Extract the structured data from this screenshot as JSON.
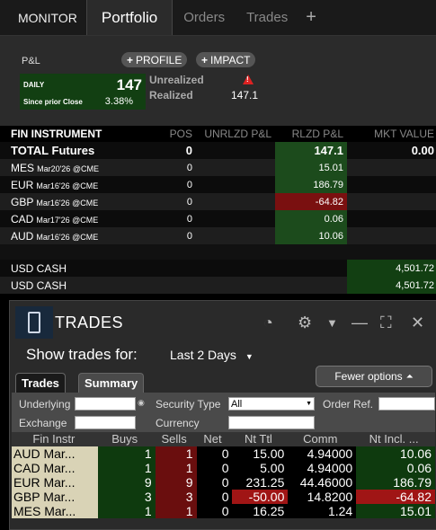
{
  "tabs": {
    "monitor": "MONITOR",
    "portfolio": "Portfolio",
    "orders": "Orders",
    "trades": "Trades",
    "add": "+"
  },
  "pnl": {
    "label": "P&L",
    "profile_btn": "PROFILE",
    "impact_btn": "IMPACT",
    "daily_label": "DAILY",
    "daily_value": "147",
    "since_prior": "Since prior Close",
    "since_pct": "3.38%",
    "unrealized_label": "Unrealized",
    "realized_label": "Realized",
    "realized_value": "147.1"
  },
  "portfolio": {
    "headers": {
      "instrument": "FIN INSTRUMENT",
      "pos": "POS",
      "unrlzd": "UNRLZD P&L",
      "rlzd": "RLZD P&L",
      "mkt": "MKT VALUE"
    },
    "total": {
      "name": "TOTAL Futures",
      "pos": "0",
      "rlzd": "147.1",
      "mkt": "0.00"
    },
    "rows": [
      {
        "sym": "MES",
        "exp": "Mar20'26 @CME",
        "pos": "0",
        "rlzd": "15.01",
        "sign": "pos"
      },
      {
        "sym": "EUR",
        "exp": "Mar16'26 @CME",
        "pos": "0",
        "rlzd": "186.79",
        "sign": "pos"
      },
      {
        "sym": "GBP",
        "exp": "Mar16'26 @CME",
        "pos": "0",
        "rlzd": "-64.82",
        "sign": "neg"
      },
      {
        "sym": "CAD",
        "exp": "Mar17'26 @CME",
        "pos": "0",
        "rlzd": "0.06",
        "sign": "pos"
      },
      {
        "sym": "AUD",
        "exp": "Mar16'26 @CME",
        "pos": "0",
        "rlzd": "10.06",
        "sign": "pos"
      }
    ],
    "cash": [
      {
        "name": "USD CASH",
        "mkt": "4,501.72"
      },
      {
        "name": "USD CASH",
        "mkt": "4,501.72"
      }
    ]
  },
  "trades_panel": {
    "title": "TRADES",
    "show_label": "Show trades for:",
    "range_value": "Last 2 Days",
    "tab_trades": "Trades",
    "tab_summary": "Summary",
    "fewer_options": "Fewer options",
    "filters": {
      "underlying": "Underlying",
      "security_type": "Security Type",
      "security_type_value": "All",
      "order_ref": "Order Ref.",
      "exchange": "Exchange",
      "currency": "Currency"
    },
    "columns": [
      "Fin Instr",
      "Buys",
      "Sells",
      "Net",
      "Nt Ttl",
      "Comm",
      "Nt Incl. ..."
    ],
    "rows": [
      {
        "fi": "AUD Mar...",
        "buys": "1",
        "sells": "1",
        "net": "0",
        "ntttl": "15.00",
        "comm": "4.94000",
        "ntincl": "10.06",
        "ntttl_sign": "pos",
        "ntincl_sign": "pos"
      },
      {
        "fi": "CAD Mar...",
        "buys": "1",
        "sells": "1",
        "net": "0",
        "ntttl": "5.00",
        "comm": "4.94000",
        "ntincl": "0.06",
        "ntttl_sign": "pos",
        "ntincl_sign": "pos"
      },
      {
        "fi": "EUR Mar...",
        "buys": "9",
        "sells": "9",
        "net": "0",
        "ntttl": "231.25",
        "comm": "44.46000",
        "ntincl": "186.79",
        "ntttl_sign": "pos",
        "ntincl_sign": "pos"
      },
      {
        "fi": "GBP Mar...",
        "buys": "3",
        "sells": "3",
        "net": "0",
        "ntttl": "-50.00",
        "comm": "14.8200",
        "ntincl": "-64.82",
        "ntttl_sign": "neg",
        "ntincl_sign": "neg"
      },
      {
        "fi": "MES Mar...",
        "buys": "1",
        "sells": "1",
        "net": "0",
        "ntttl": "16.25",
        "comm": "1.24",
        "ntincl": "15.01",
        "ntttl_sign": "pos",
        "ntincl_sign": "pos"
      }
    ]
  }
}
